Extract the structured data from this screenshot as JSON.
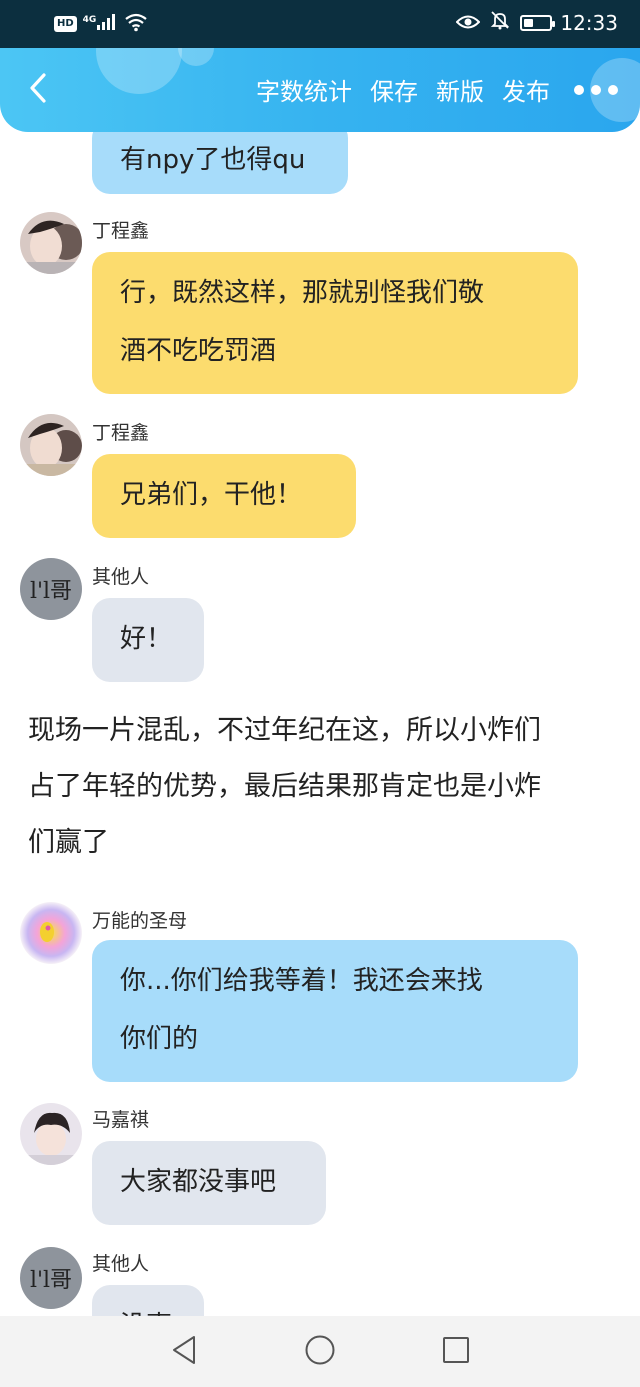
{
  "status_bar": {
    "hd": "HD",
    "network": "4G",
    "time": "12:33",
    "icons": [
      "signal-icon",
      "wifi-icon",
      "eye-icon",
      "bell-off-icon",
      "battery-icon"
    ],
    "battery_level": 0.3
  },
  "header": {
    "actions": {
      "word_count": "字数统计",
      "save": "保存",
      "new_version": "新版",
      "publish": "发布"
    },
    "icons": [
      "back-icon",
      "more-icon"
    ],
    "color": "#36b3f0"
  },
  "messages": [
    {
      "text": "有npy了也得qu",
      "style": "blue"
    },
    {
      "sender": "丁程鑫",
      "line1": "行，既然这样，那就别怪我们敬",
      "line2": "酒不吃吃罚酒",
      "style": "yellow"
    },
    {
      "sender": "丁程鑫",
      "text": "兄弟们，干他！",
      "style": "yellow"
    },
    {
      "sender": "其他人",
      "text": "好！",
      "style": "gray",
      "avatar_text": "l'l哥"
    },
    {
      "narration": [
        "现场一片混乱，不过年纪在这，所以小炸们",
        "占了年轻的优势，最后结果那肯定也是小炸",
        "们赢了"
      ]
    },
    {
      "sender": "万能的圣母",
      "line1": "你...你们给我等着！我还会来找",
      "line2": "你们的",
      "style": "blue"
    },
    {
      "sender": "马嘉祺",
      "text": "大家都没事吧",
      "style": "gray"
    },
    {
      "sender": "其他人",
      "text": "没事",
      "style": "gray",
      "avatar_text": "l'l哥"
    }
  ],
  "colors": {
    "blue_bubble": "#a7dcfa",
    "yellow_bubble": "#fcdc6e",
    "gray_bubble": "#e1e6ee"
  },
  "nav": {
    "icons": [
      "back-triangle-icon",
      "home-circle-icon",
      "recents-square-icon"
    ]
  }
}
